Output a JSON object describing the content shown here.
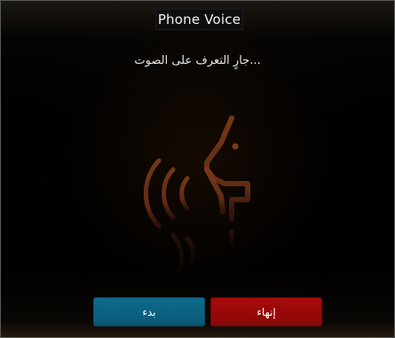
{
  "window": {
    "title": "Phone Voice"
  },
  "status": {
    "text": "...جارٍ التعرف على الصوت"
  },
  "logo": {
    "icon": "voice-recognition-head-icon",
    "color": "#7a3a18"
  },
  "buttons": {
    "start_label": "بدء",
    "end_label": "إنهاء",
    "start_color": "#0e6b8c",
    "end_color": "#a80a0a"
  }
}
